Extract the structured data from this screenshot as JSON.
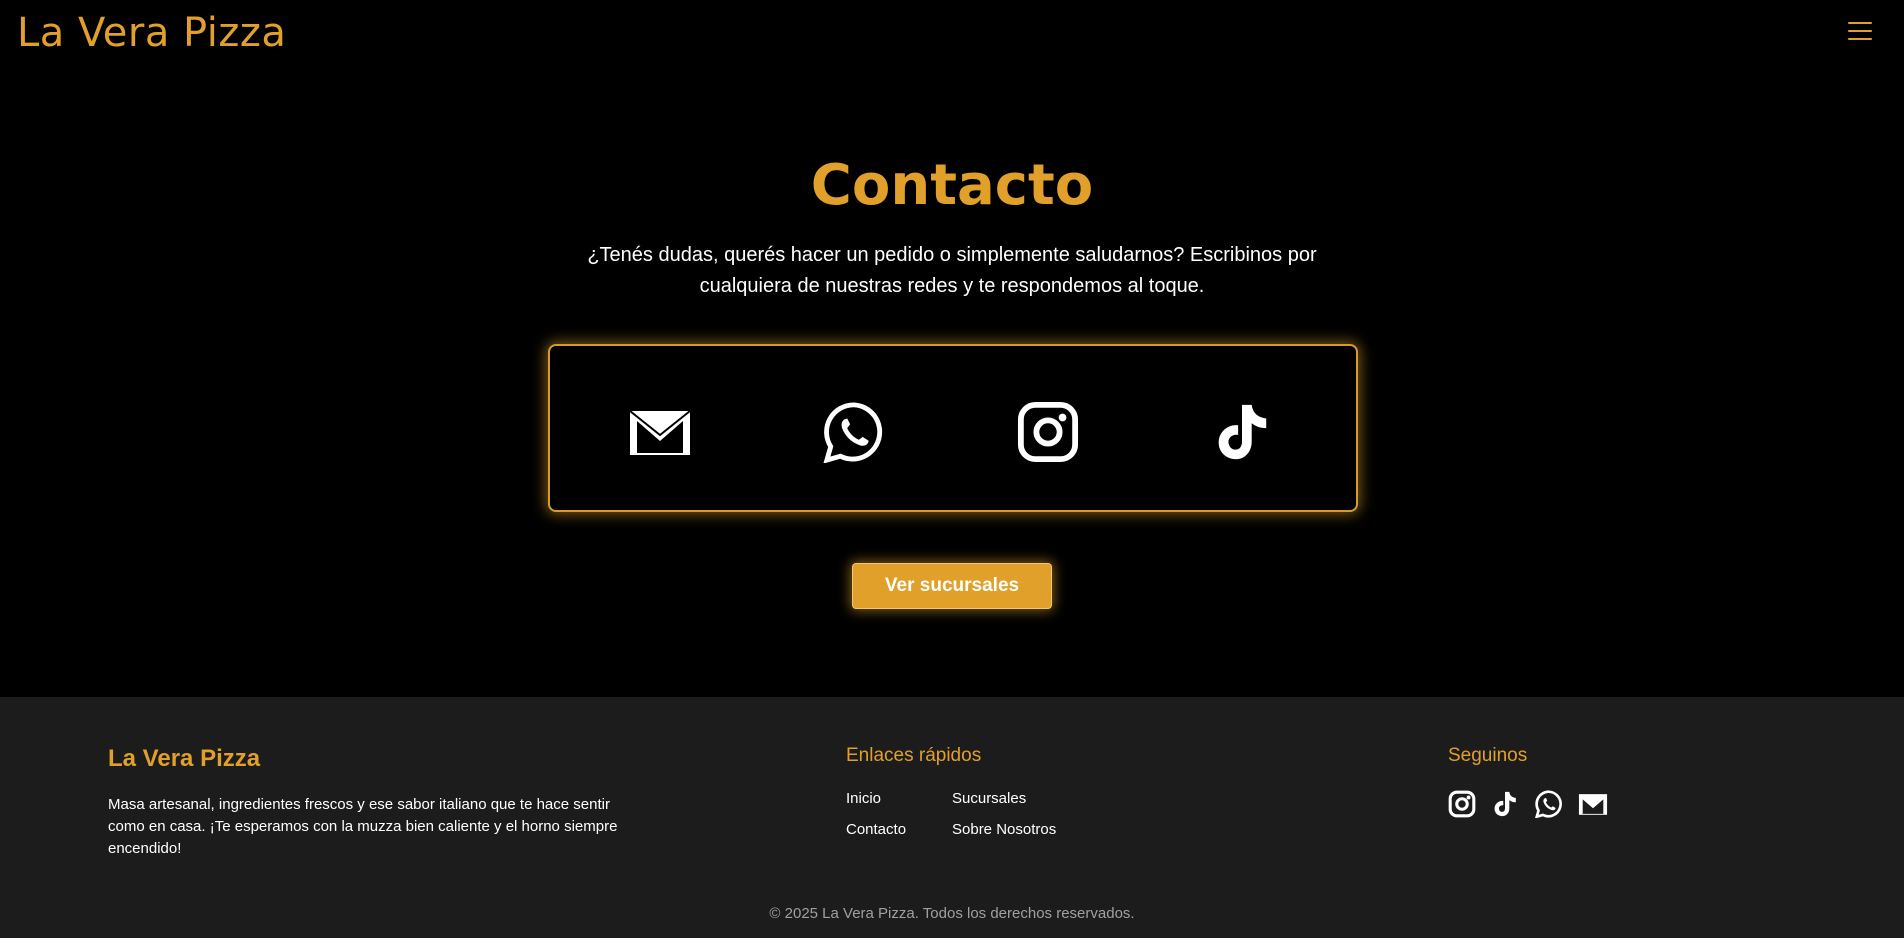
{
  "header": {
    "brand": "La Vera Pizza",
    "menu_icon": "hamburger-menu-icon"
  },
  "contact": {
    "title": "Contacto",
    "intro": "¿Tenés dudas, querés hacer un pedido o simplemente saludarnos? Escribinos por cualquiera de nuestras redes y te respondemos al toque.",
    "social_icons": [
      "gmail-icon",
      "whatsapp-icon",
      "instagram-icon",
      "tiktok-icon"
    ],
    "cta_label": "Ver sucursales"
  },
  "footer": {
    "brand": "La Vera Pizza",
    "description": "Masa artesanal, ingredientes frescos y ese sabor italiano que te hace sentir como en casa. ¡Te esperamos con la muzza bien caliente y el horno siempre encendido!",
    "links_title": "Enlaces rápidos",
    "links": [
      "Inicio",
      "Sucursales",
      "Contacto",
      "Sobre Nosotros"
    ],
    "follow_title": "Seguinos",
    "follow_icons": [
      "instagram-icon",
      "tiktok-icon",
      "whatsapp-icon",
      "gmail-icon"
    ],
    "copyright": "© 2025 La Vera Pizza. Todos los derechos reservados."
  },
  "colors": {
    "accent": "#e0a02a",
    "background": "#000000",
    "footer_background": "#1c1c1c",
    "muted_text": "#a0a0a0"
  }
}
